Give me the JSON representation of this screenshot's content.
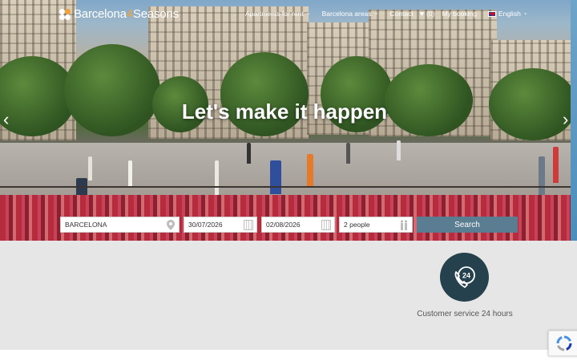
{
  "brand": {
    "name_part1": "Barcelona",
    "name_part2": "4",
    "name_part3": "Seasons",
    "accent": "#f2a33a"
  },
  "nav": {
    "apartments": "Apartments for rent",
    "areas": "Barcelona areas",
    "contact": "Contact",
    "favorites_count": "(0)",
    "my_booking": "My booking",
    "language": "English"
  },
  "hero": {
    "headline": "Let's make it happen"
  },
  "search": {
    "destination": "BARCELONA",
    "checkin": "30/07/2026",
    "checkout": "02/08/2026",
    "guests": "2 people",
    "button": "Search"
  },
  "services": {
    "customer_service": "Customer service 24 hours",
    "badge_number": "24"
  },
  "colors": {
    "button": "#5b7d91",
    "badge": "#25414d"
  }
}
